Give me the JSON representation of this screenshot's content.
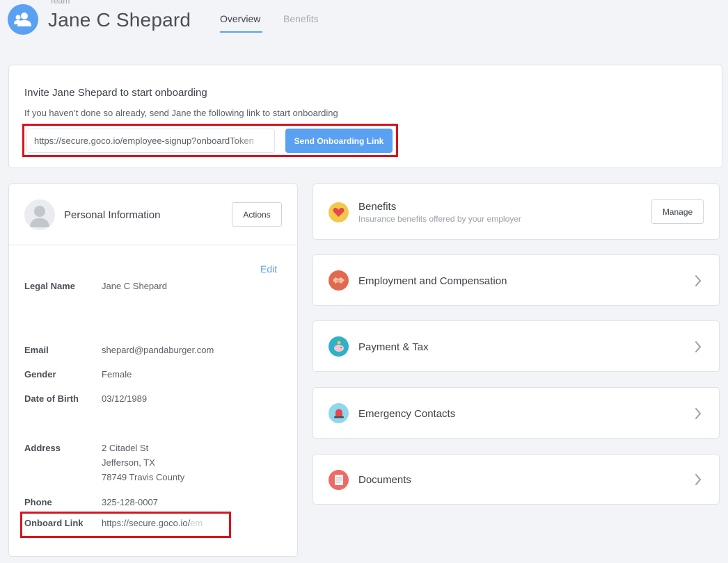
{
  "header": {
    "breadcrumb": "Team",
    "title": "Jane C Shepard",
    "tabs": [
      {
        "label": "Overview",
        "active": true
      },
      {
        "label": "Benefits",
        "active": false
      }
    ]
  },
  "invite": {
    "title": "Invite Jane Shepard to start onboarding",
    "subtitle": "If you haven’t done so already, send Jane the following link to start onboarding",
    "link_value": "https://secure.goco.io/employee-signup?onboardToken",
    "send_button": "Send Onboarding Link"
  },
  "personal": {
    "title": "Personal Information",
    "actions_button": "Actions",
    "edit_link": "Edit",
    "fields": {
      "legal_name": {
        "label": "Legal Name",
        "value": "Jane C Shepard"
      },
      "email": {
        "label": "Email",
        "value": "shepard@pandaburger.com"
      },
      "gender": {
        "label": "Gender",
        "value": "Female"
      },
      "dob": {
        "label": "Date of Birth",
        "value": "03/12/1989"
      },
      "address": {
        "label": "Address",
        "line1": "2 Citadel St",
        "line2": "Jefferson, TX",
        "line3": "78749 Travis County"
      },
      "phone": {
        "label": "Phone",
        "value": "325-128-0007"
      },
      "onboard_link": {
        "label": "Onboard Link",
        "value": "https://secure.goco.io/",
        "value_faded": "em"
      }
    }
  },
  "sections": {
    "benefits": {
      "title": "Benefits",
      "subtitle": "Insurance benefits offered by your employer",
      "button": "Manage"
    },
    "employment": {
      "title": "Employment and Compensation"
    },
    "payment": {
      "title": "Payment & Tax"
    },
    "emergency": {
      "title": "Emergency Contacts"
    },
    "documents": {
      "title": "Documents"
    }
  },
  "colors": {
    "accent": "#5aa1f2",
    "highlight_box": "#d9141d",
    "background": "#f2f4f7"
  }
}
